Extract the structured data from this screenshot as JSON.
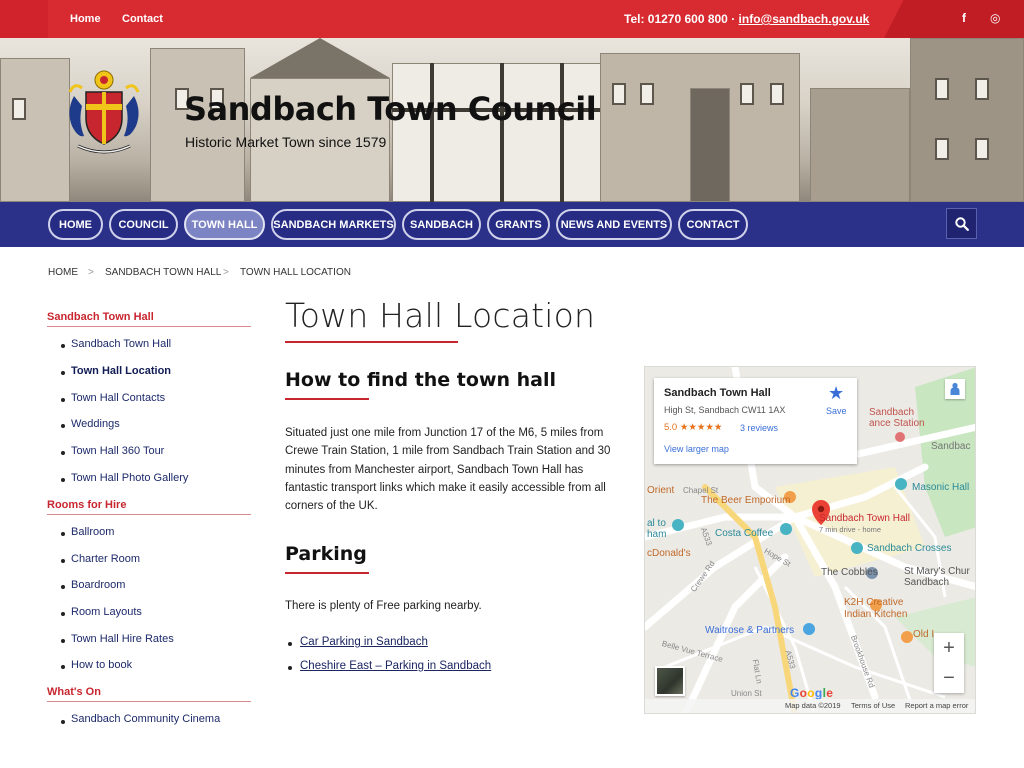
{
  "topbar": {
    "home": "Home",
    "contact": "Contact",
    "tel_text": "Tel: 01270 600 800 · ",
    "email": "info@sandbach.gov.uk",
    "facebook_glyph": "f",
    "instagram_glyph": "◎"
  },
  "header": {
    "title": "Sandbach Town Council",
    "subtitle": "Historic Market Town since 1579"
  },
  "nav": {
    "items": [
      {
        "label": "HOME"
      },
      {
        "label": "COUNCIL"
      },
      {
        "label": "TOWN HALL",
        "active": true
      },
      {
        "label": "SANDBACH MARKETS"
      },
      {
        "label": "SANDBACH"
      },
      {
        "label": "GRANTS"
      },
      {
        "label": "NEWS AND EVENTS"
      },
      {
        "label": "CONTACT"
      }
    ],
    "search_icon": "search-icon"
  },
  "breadcrumb": {
    "items": [
      "HOME",
      "SANDBACH TOWN HALL",
      "TOWN HALL LOCATION"
    ],
    "separator": ">"
  },
  "sidebar": {
    "sections": [
      {
        "heading": "Sandbach Town Hall",
        "items": [
          "Sandbach Town Hall",
          "Town Hall Location",
          "Town Hall Contacts",
          "Weddings",
          "Town Hall 360 Tour",
          "Town Hall Photo Gallery"
        ]
      },
      {
        "heading": "Rooms for Hire",
        "items": [
          "Ballroom",
          "Charter Room",
          "Boardroom",
          "Room Layouts",
          "Town Hall Hire Rates",
          "How to book"
        ]
      },
      {
        "heading": "What's On",
        "items": [
          "Sandbach Community Cinema"
        ]
      }
    ],
    "current": "Town Hall Location"
  },
  "main": {
    "page_title": "Town Hall Location",
    "section1_heading": "How to find the town hall",
    "section1_text": "Situated just one mile from Junction 17 of the M6, 5 miles from Crewe Train Station, 1 mile from Sandbach Train Station and 30 minutes from Manchester airport, Sandbach Town Hall has fantastic transport links which make it easily accessible from all corners of the UK.",
    "section2_heading": "Parking",
    "section2_text": "There is plenty of Free parking nearby.",
    "links": [
      "Car Parking in Sandbach",
      "Cheshire East – Parking in Sandbach"
    ]
  },
  "map": {
    "card": {
      "title": "Sandbach Town Hall",
      "address": "High St, Sandbach CW11 1AX",
      "rating": "5.0 ★★★★★",
      "reviews": "3 reviews",
      "larger_map": "View larger map",
      "save": "Save"
    },
    "labels": {
      "station": "Sandbach",
      "station2": "ance Station",
      "sandbac": "Sandbac",
      "masonic": "Masonic Hall",
      "orient": "Orient",
      "chapel": "Chapel St",
      "emporium": "The Beer Emporium",
      "alto": "al to",
      "ham": "ham",
      "costa": "Costa Coffee",
      "town_hall": "Sandbach Town Hall",
      "drive": "7 min drive - home",
      "mcdonalds": "cDonald's",
      "crosses": "Sandbach Crosses",
      "cobbles": "The Cobbles",
      "st_marys": "St Mary's Chur",
      "sandbach2": "Sandbach",
      "k2h": "K2H Creative",
      "indian": "Indian Kitchen",
      "waitrose": "Waitrose & Partners",
      "old": "Old I",
      "crewe_rd": "Crewe Rd",
      "a533": "A533",
      "a533b": "A533",
      "union": "Union St",
      "belle": "Belle Vue Terrace",
      "hope": "Hope St",
      "flat": "Flat Ln",
      "brookhouse": "Brookhouse Rd"
    },
    "zoom_in": "+",
    "zoom_out": "−",
    "google": "Google",
    "footer": {
      "data": "Map data ©2019",
      "terms": "Terms of Use",
      "report": "Report a map error"
    }
  },
  "colors": {
    "brand_red": "#d1232b",
    "nav_blue": "#2b3088",
    "active_nav": "#7d84c4",
    "link_blue": "#1b2560"
  }
}
